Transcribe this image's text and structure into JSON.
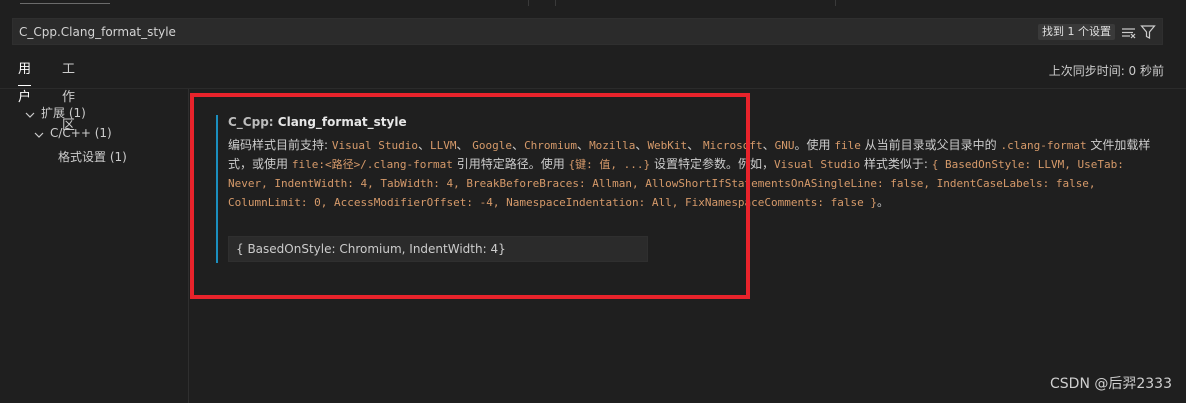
{
  "search": {
    "value": "C_Cpp.Clang_format_style",
    "result_count": "找到 1 个设置",
    "icons": [
      "clear-filter-icon",
      "filter-icon"
    ]
  },
  "tabs": [
    {
      "label": "用户",
      "active": true
    },
    {
      "label": "工作区",
      "active": false
    }
  ],
  "sync_status": "上次同步时间: 0 秒前",
  "tree": [
    {
      "label": "扩展 (1)"
    },
    {
      "label": "C/C++ (1)"
    },
    {
      "label": "格式设置 (1)"
    }
  ],
  "setting": {
    "prefix": "C_Cpp: ",
    "name": "Clang_format_style",
    "desc": {
      "t1": "编码样式目前支持: ",
      "c1": "Visual Studio",
      "t2": "、",
      "c2": "LLVM",
      "t3": "、 ",
      "c3": "Google",
      "t4": "、",
      "c4": "Chromium",
      "t5": "、",
      "c5": "Mozilla",
      "t6": "、",
      "c6": "WebKit",
      "t7": "、 ",
      "c7": "Microsoft",
      "t8": "、",
      "c8": "GNU",
      "t9": "。使用 ",
      "c9": "file",
      "t10": " 从当前目录或父目录中的 ",
      "c10": ".clang-format",
      "t11": " 文件加载样式，或使用 ",
      "c11": "file:<路径>/.clang-format",
      "t12": " 引用特定路径。使用 ",
      "c12": "{键: 值, ...}",
      "t13": " 设置特定参数。例如，",
      "c13": "Visual Studio",
      "t14": " 样式类似于: ",
      "c14": "{ BasedOnStyle: LLVM, UseTab: Never, IndentWidth: 4, TabWidth: 4, BreakBeforeBraces: Allman, AllowShortIfStatementsOnASingleLine: false, IndentCaseLabels: false, ColumnLimit: 0, AccessModifierOffset: -4, NamespaceIndentation: All, FixNamespaceComments: false }",
      "t15": "。"
    },
    "value": "{ BasedOnStyle: Chromium, IndentWidth: 4}"
  },
  "watermark": "CSDN @后羿2333",
  "colors": {
    "accent_border": "#1b8fbf",
    "highlight_box": "#e8232b",
    "code": "#d69a6a"
  }
}
